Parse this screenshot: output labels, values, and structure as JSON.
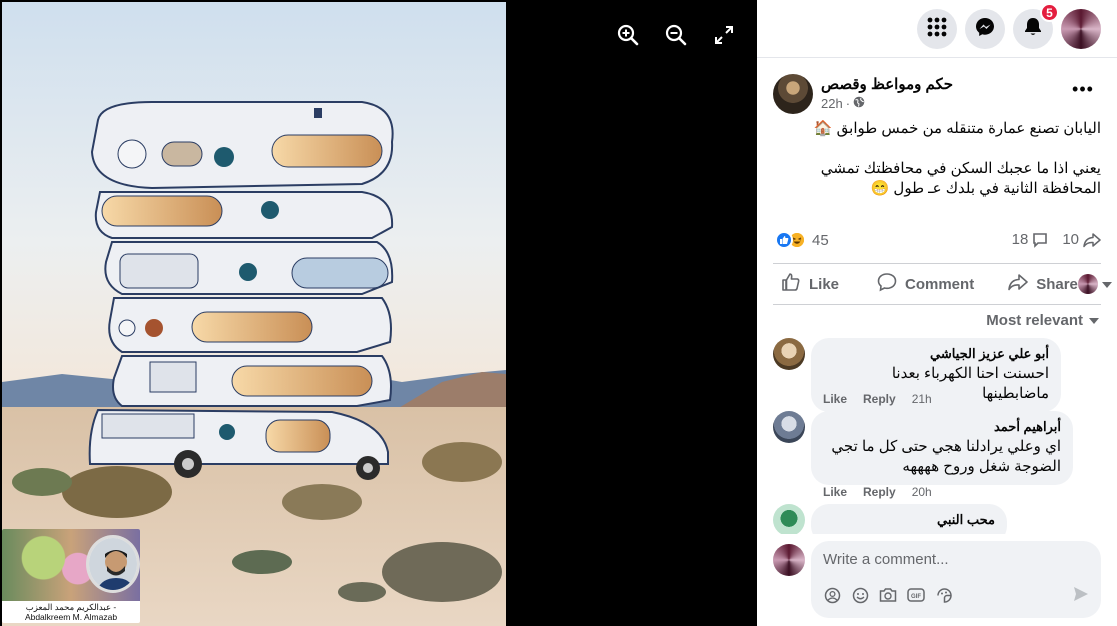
{
  "viewer": {
    "tools": [
      "zoom-in",
      "zoom-out",
      "fullscreen"
    ],
    "watermark_text": "عبدالكريم محمد المعزب - Abdalkreem M. Almazab"
  },
  "topbar": {
    "notification_count": "5"
  },
  "post": {
    "author": "حكم ومواعظ وقصص",
    "time": "22h",
    "audience_icon": "globe-icon",
    "text_lines": [
      "اليابان تصنع عمارة متنقله من خمس طوابق 🏠",
      "يعني اذا ما عجبك السكن في محافظتك تمشي المحافظة الثانية في بلدك عـ طول 😁"
    ],
    "reactions": {
      "count": "45",
      "types": [
        "like",
        "haha"
      ]
    },
    "comments_count": "18",
    "shares_count": "10",
    "actions": {
      "like": "Like",
      "comment": "Comment",
      "share": "Share"
    },
    "sort_label": "Most relevant"
  },
  "comments": [
    {
      "name": "أبو علي عزيز الجياشي",
      "text": "احسنت احنا الكهرباء بعدنا ماضابطينها",
      "like": "Like",
      "reply": "Reply",
      "time": "21h"
    },
    {
      "name": "أبراهيم أحمد",
      "text": "اي وعلي يرادلنا هجي حتى كل ما تجي الضوجة شغل وروح ههههه",
      "like": "Like",
      "reply": "Reply",
      "time": "20h"
    },
    {
      "name": "محب النبي",
      "text": "",
      "like": "",
      "reply": "",
      "time": ""
    }
  ],
  "composer": {
    "placeholder": "Write a comment..."
  },
  "colors": {
    "accent": "#1877f2",
    "badge": "#e41e3f",
    "secondary_text": "#65676b",
    "bubble": "#f0f2f5"
  }
}
